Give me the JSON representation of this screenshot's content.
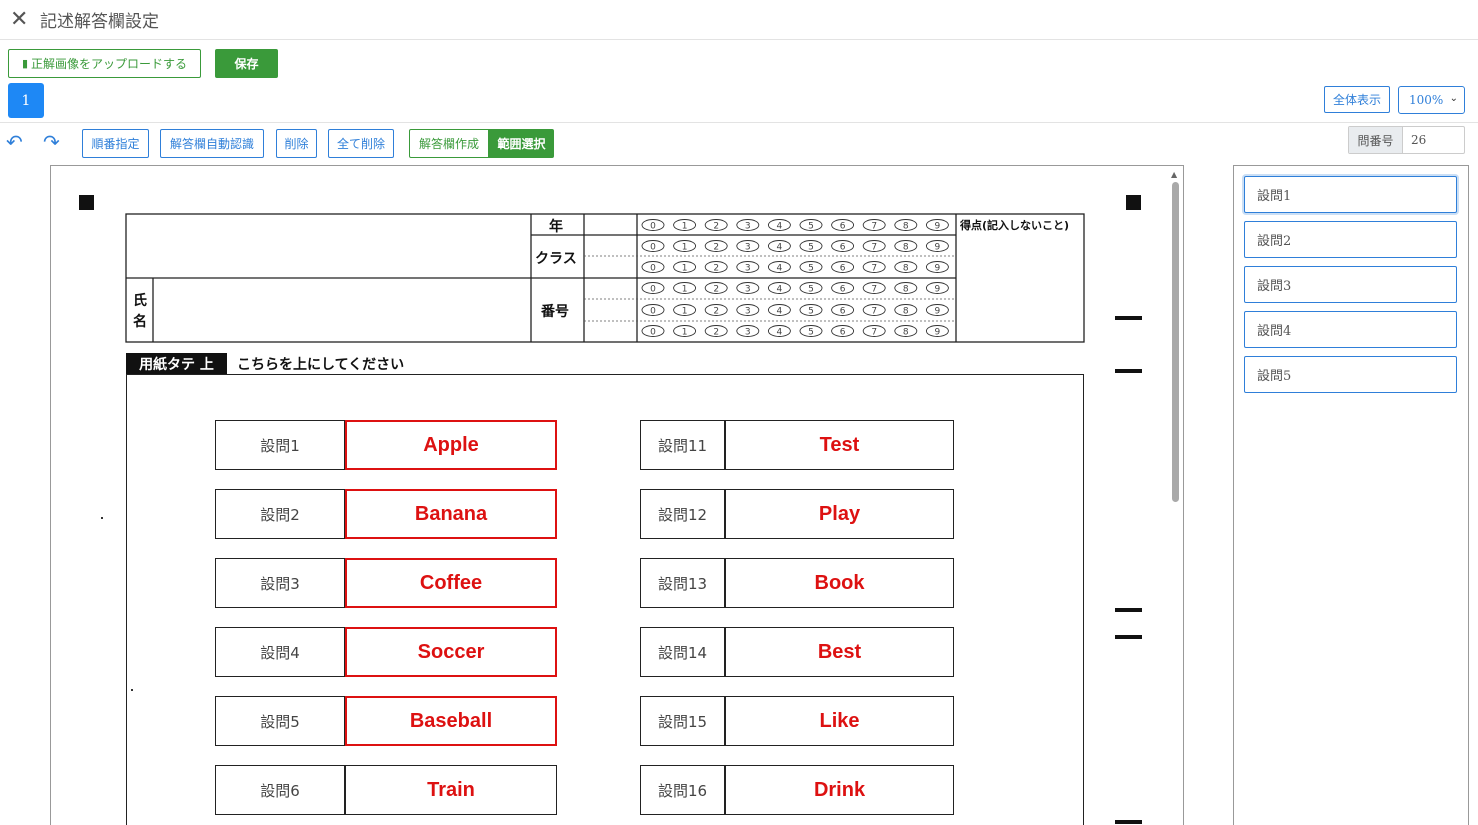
{
  "window": {
    "title": "記述解答欄設定"
  },
  "toolbar": {
    "upload_label": "正解画像をアップロードする",
    "save_label": "保存",
    "page_tab": "1",
    "fit_label": "全体表示",
    "zoom_value": "100%",
    "order_label": "順番指定",
    "auto_detect_label": "解答欄自動認識",
    "delete_label": "削除",
    "delete_all_label": "全て削除",
    "create_label": "解答欄作成",
    "range_select_label": "範囲選択",
    "question_number_label": "問番号",
    "question_number_value": "26"
  },
  "sheet": {
    "header": {
      "year": "年",
      "class": "クラス",
      "number": "番号",
      "name1": "氏",
      "name2": "名",
      "score": "得点(記入しないこと)",
      "digits": [
        "0",
        "1",
        "2",
        "3",
        "4",
        "5",
        "6",
        "7",
        "8",
        "9"
      ]
    },
    "orientation_tag": "用紙タテ 上",
    "orientation_note": "こちらを上にしてください",
    "left_column": [
      {
        "label": "設問1",
        "answer": "Apple",
        "selected": true
      },
      {
        "label": "設問2",
        "answer": "Banana",
        "selected": true
      },
      {
        "label": "設問3",
        "answer": "Coffee",
        "selected": true
      },
      {
        "label": "設問4",
        "answer": "Soccer",
        "selected": true
      },
      {
        "label": "設問5",
        "answer": "Baseball",
        "selected": true
      },
      {
        "label": "設問6",
        "answer": "Train",
        "selected": false
      }
    ],
    "right_column": [
      {
        "label": "設問11",
        "answer": "Test"
      },
      {
        "label": "設問12",
        "answer": "Play"
      },
      {
        "label": "設問13",
        "answer": "Book"
      },
      {
        "label": "設問14",
        "answer": "Best"
      },
      {
        "label": "設問15",
        "answer": "Like"
      },
      {
        "label": "設問16",
        "answer": "Drink"
      }
    ]
  },
  "question_list": [
    "設問1",
    "設問2",
    "設問3",
    "設問4",
    "設問5"
  ],
  "colors": {
    "accent": "#1e88f5",
    "save": "#3a9a3a",
    "answer_red": "#dd1111"
  }
}
